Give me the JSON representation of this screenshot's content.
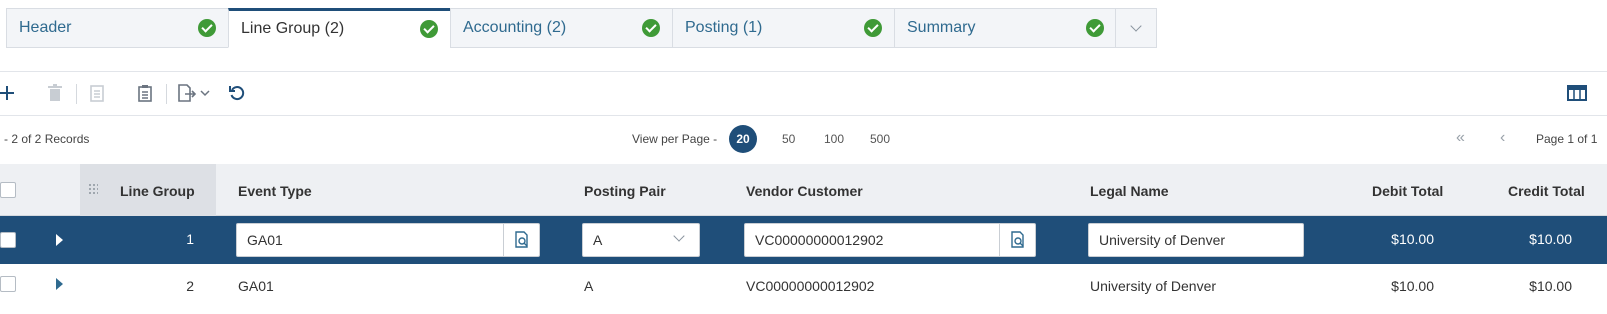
{
  "tabs": [
    {
      "label": "Header",
      "state": "complete"
    },
    {
      "label": "Line Group (2)",
      "state": "complete",
      "active": true
    },
    {
      "label": "Accounting (2)",
      "state": "complete"
    },
    {
      "label": "Posting (1)",
      "state": "complete"
    },
    {
      "label": "Summary",
      "state": "complete"
    }
  ],
  "toolbar": {
    "icons": [
      "add-icon",
      "delete-icon",
      "copy-icon",
      "paste-icon",
      "export-icon",
      "refresh-icon",
      "grid-settings-icon"
    ]
  },
  "records": {
    "count_text": "- 2 of 2 Records",
    "view_per_page_label": "View per Page -",
    "options": [
      "20",
      "50",
      "100",
      "500"
    ],
    "selected": "20",
    "page_label": "Page 1 of 1"
  },
  "grid": {
    "columns": [
      "Line Group",
      "Event Type",
      "Posting Pair",
      "Vendor Customer",
      "Legal Name",
      "Debit Total",
      "Credit Total"
    ],
    "rows": [
      {
        "line_group": "1",
        "event_type": "GA01",
        "posting_pair": "A",
        "vendor_customer": "VC00000000012902",
        "legal_name": "University of Denver",
        "debit_total": "$10.00",
        "credit_total": "$10.00"
      },
      {
        "line_group": "2",
        "event_type": "GA01",
        "posting_pair": "A",
        "vendor_customer": "VC00000000012902",
        "legal_name": "University of Denver",
        "debit_total": "$10.00",
        "credit_total": "$10.00"
      }
    ]
  },
  "colors": {
    "brand": "#1f4e79",
    "success": "#3f9a37",
    "link": "#2f6a8f"
  }
}
